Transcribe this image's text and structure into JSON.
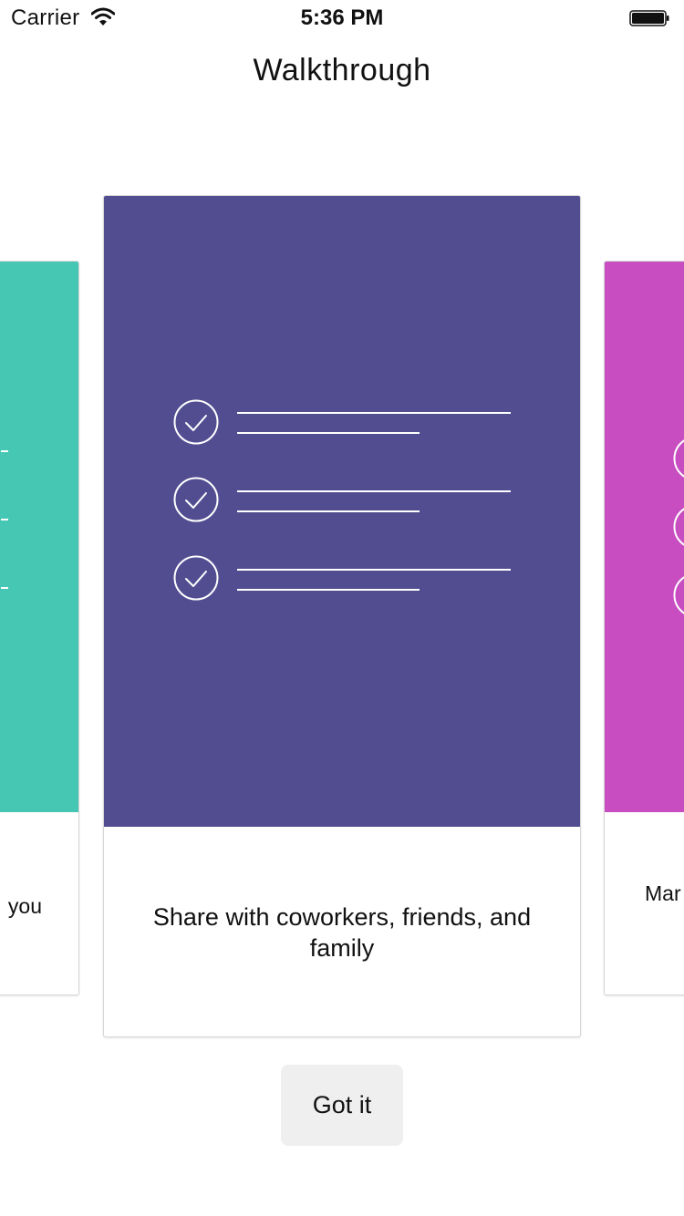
{
  "status_bar": {
    "carrier": "Carrier",
    "time": "5:36 PM",
    "wifi_icon": "wifi-icon",
    "battery_icon": "battery-icon"
  },
  "nav": {
    "title": "Walkthrough"
  },
  "cards": {
    "left": {
      "text": "you",
      "color": "#45C7B3"
    },
    "center": {
      "text": "Share with coworkers, friends, and family",
      "color": "#524D91",
      "icon": "checklist-icon"
    },
    "right": {
      "text": "Mar",
      "color": "#C74DC1"
    }
  },
  "actions": {
    "got_it_label": "Got it"
  }
}
